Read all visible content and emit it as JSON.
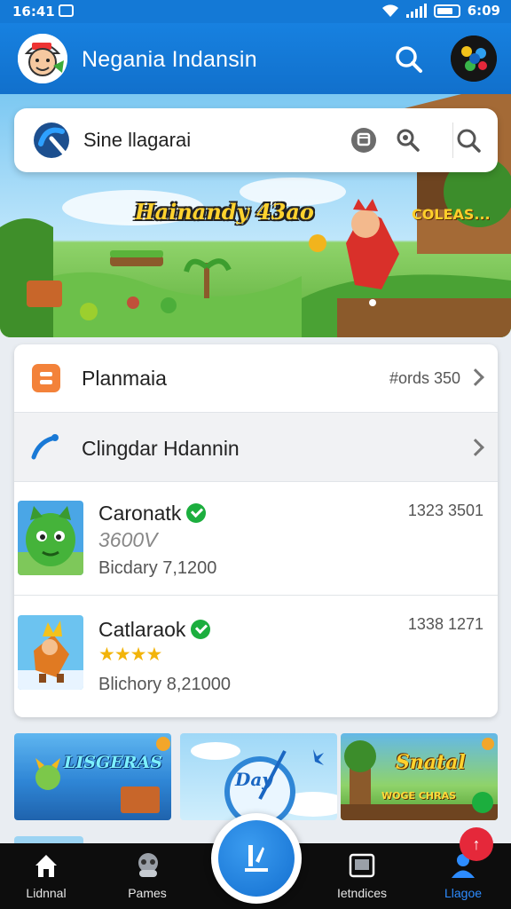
{
  "status_bar": {
    "time": "16:41",
    "battery_time": "6:09"
  },
  "app_bar": {
    "title": "Negania Indansin"
  },
  "search": {
    "text": "Sine llagarai"
  },
  "hero": {
    "title": "Hainandy 43ao",
    "sign": "COLEAS..."
  },
  "menu": {
    "items": [
      {
        "label": "Planmaia",
        "meta": "#ords 350"
      },
      {
        "label": "Clingdar Hdannin",
        "meta": ""
      }
    ]
  },
  "games": [
    {
      "name": "Caronatk",
      "price": "3600V",
      "subtitle": "Bicdary 7,1200",
      "number": "1323 3501"
    },
    {
      "name": "Catlaraok",
      "rating": 4,
      "rating_text": "★★★★",
      "subtitle": "Blichory 8,21000",
      "number": "1338 1271"
    }
  ],
  "promos": [
    {
      "title": "LISGERAS"
    },
    {
      "title": "Day"
    },
    {
      "title": "Snatal",
      "subtitle": "WOGE CHRAS"
    }
  ],
  "bottom_nav": {
    "items": [
      {
        "label": "Lidnnal",
        "icon": "home-icon"
      },
      {
        "label": "Pames",
        "icon": "games-icon"
      },
      {
        "label": "Ietndices",
        "icon": "gallery-icon"
      },
      {
        "label": "Llagoe",
        "icon": "profile-icon",
        "active": true
      }
    ],
    "fab_icon": "center-action-icon",
    "notification_badge": "↑"
  },
  "colors": {
    "primary": "#1479d6",
    "nav_bg": "#0d0d0d",
    "verified": "#1cae3e",
    "active_nav": "#2d8cff",
    "badge": "#e5283a"
  }
}
